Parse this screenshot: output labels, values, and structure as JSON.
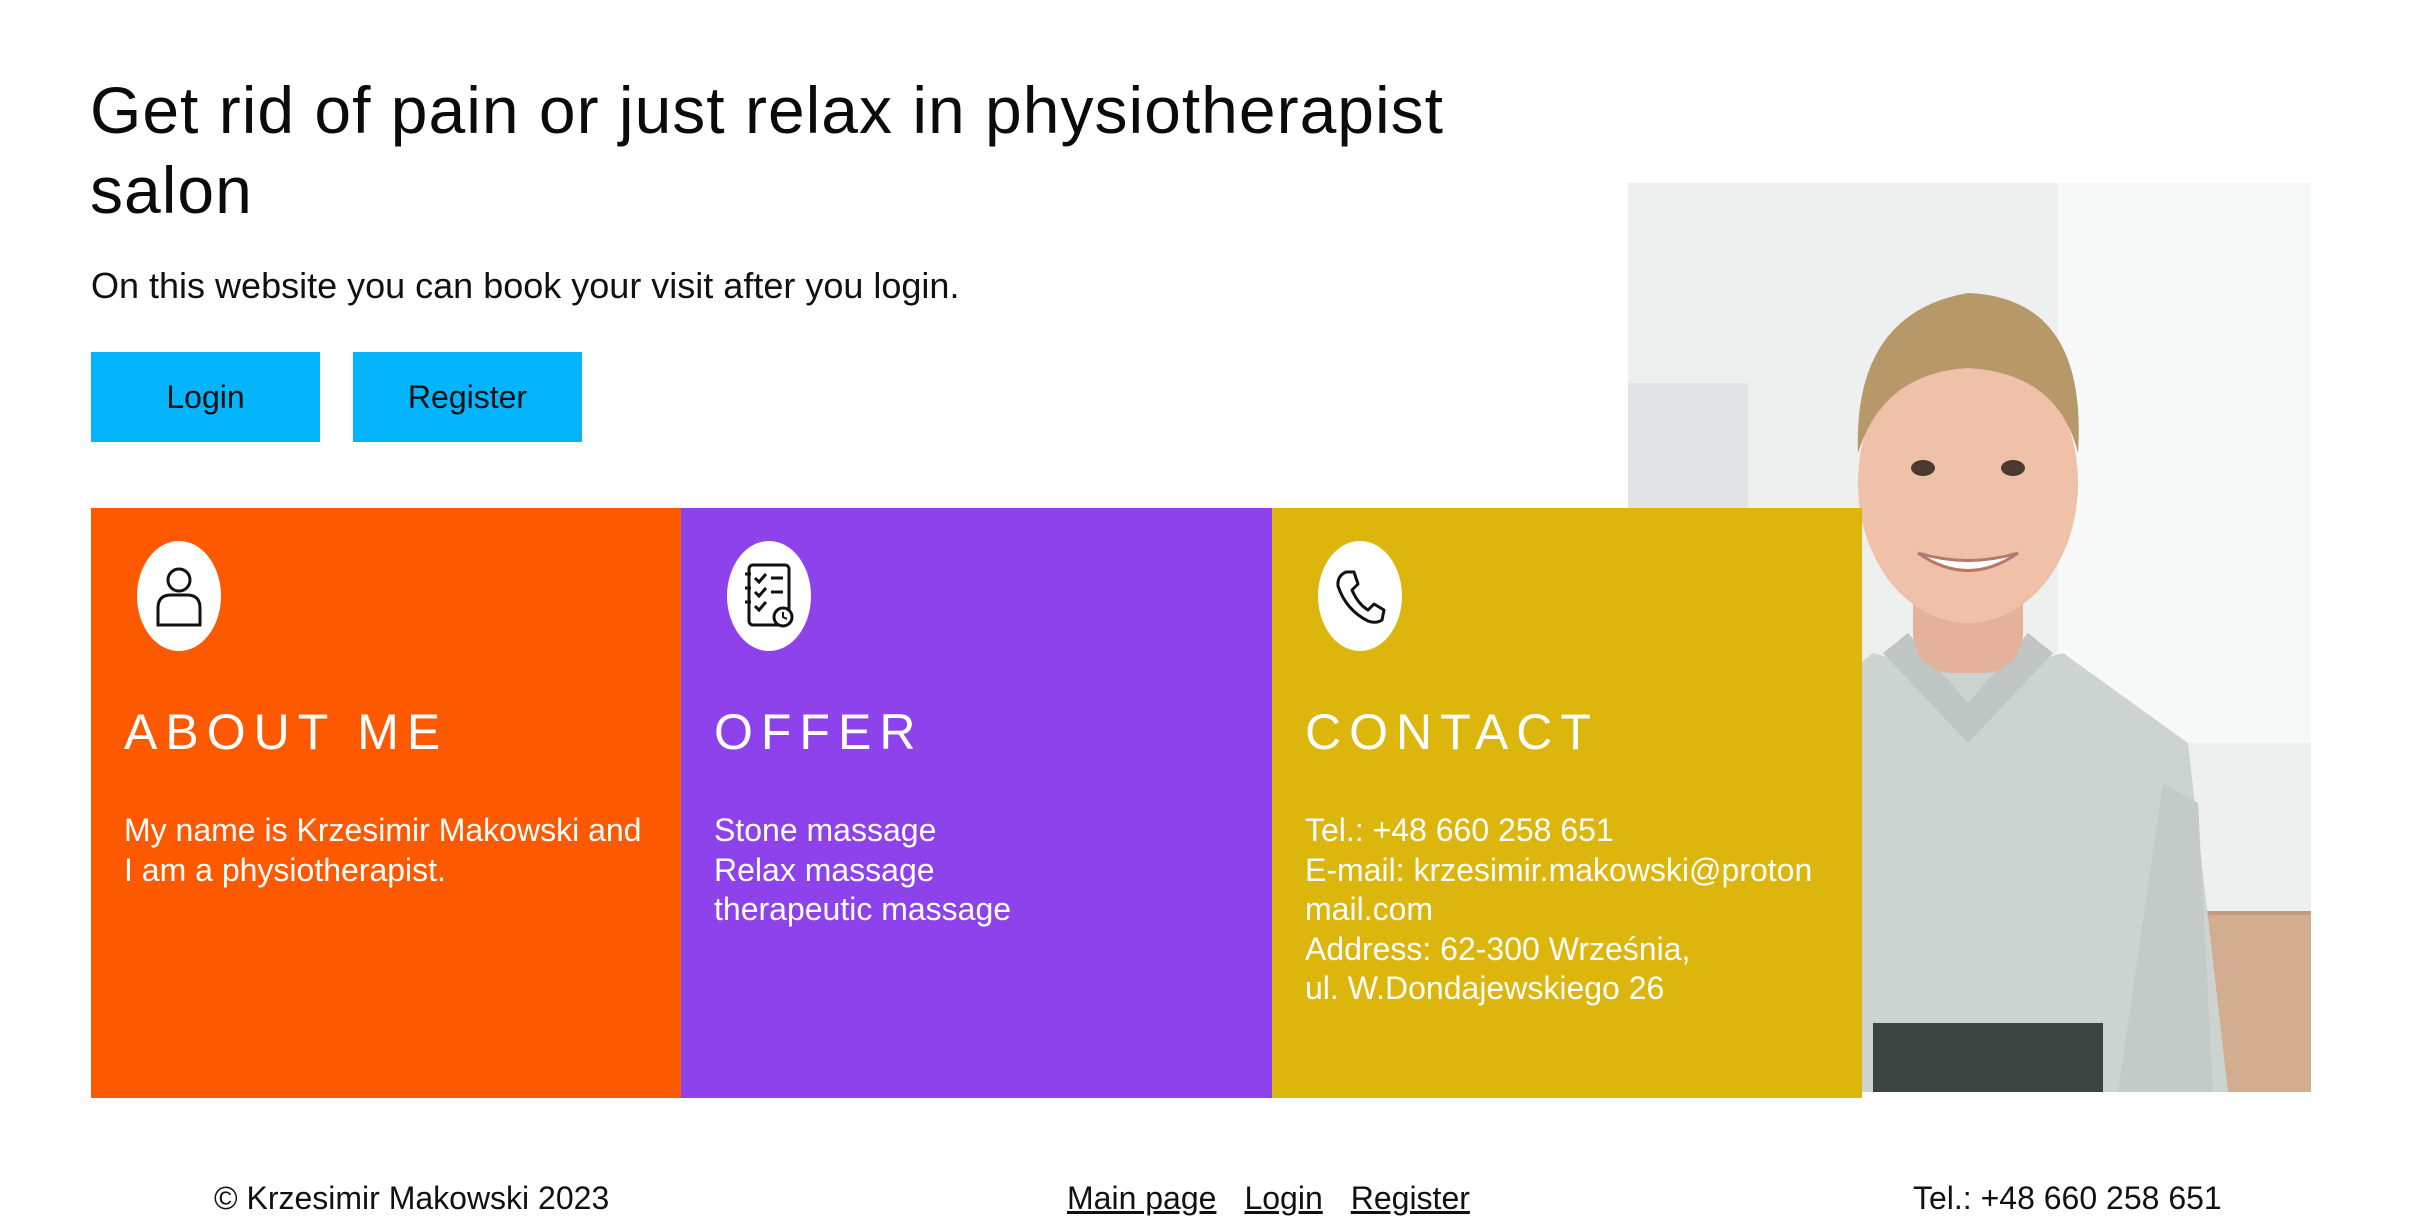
{
  "hero": {
    "title": "Get rid of pain or just relax in physiotherapist salon",
    "subtitle": "On this website you can book your visit after you login.",
    "login_label": "Login",
    "register_label": "Register",
    "button_color": "#04b4fd"
  },
  "cards": [
    {
      "title": "ABOUT ME",
      "icon": "person-icon",
      "color": "#fd5900",
      "lines": [
        "My name is Krzesimir Makowski and I am a physiotherapist."
      ]
    },
    {
      "title": "OFFER",
      "icon": "checklist-icon",
      "color": "#8e42eb",
      "lines": [
        "Stone massage",
        "Relax massage",
        "therapeutic massage"
      ]
    },
    {
      "title": "CONTACT",
      "icon": "phone-icon",
      "color": "#dcb50d",
      "lines": [
        "Tel.: +48 660 258 651",
        "E-mail: krzesimir.makowski@protonmail.com",
        "Address: 62-300 Września,",
        "ul. W.Dondajewskiego 26"
      ]
    }
  ],
  "footer": {
    "copyright": "© Krzesimir Makowski 2023",
    "nav": [
      "Main page",
      "Login",
      "Register"
    ],
    "tel": "Tel.: +48 660 258 651"
  }
}
